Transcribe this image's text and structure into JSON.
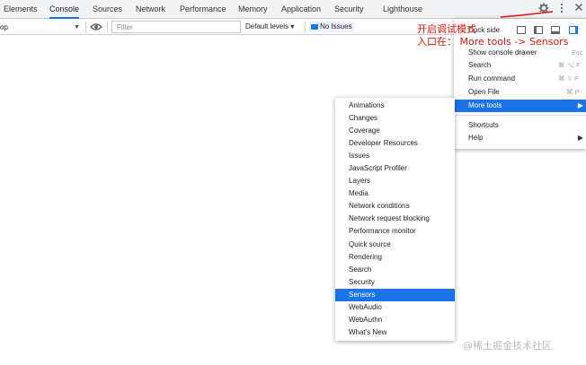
{
  "tabs": [
    {
      "label": "Elements",
      "active": false
    },
    {
      "label": "Console",
      "active": true
    },
    {
      "label": "Sources",
      "active": false
    },
    {
      "label": "Network",
      "active": false
    },
    {
      "label": "Performance",
      "active": false
    },
    {
      "label": "Memory",
      "active": false
    },
    {
      "label": "Application",
      "active": false
    },
    {
      "label": "Security",
      "active": false
    },
    {
      "label": "Lighthouse",
      "active": false
    }
  ],
  "toolbar": {
    "context_value": "op",
    "filter_placeholder": "Filter",
    "levels_label": "Default levels ▾",
    "issues_label": "No Issues"
  },
  "main_menu": {
    "dock_side_label": "Dock side",
    "items": [
      {
        "label": "Show console drawer",
        "shortcut": "Esc",
        "highlighted": false
      },
      {
        "label": "Search",
        "shortcut": "⌘ ⌥ F",
        "highlighted": false
      },
      {
        "label": "Run command",
        "shortcut": "⌘ ⇧ P",
        "highlighted": false
      },
      {
        "label": "Open File",
        "shortcut": "⌘ P",
        "highlighted": false
      },
      {
        "label": "More tools",
        "shortcut": "",
        "submenu_arrow": "▶",
        "highlighted": true
      },
      {
        "label": "Shortcuts",
        "shortcut": "",
        "highlighted": false
      },
      {
        "label": "Help",
        "shortcut": "",
        "submenu_arrow": "▶",
        "highlighted": false
      }
    ]
  },
  "more_tools": {
    "items": [
      "Animations",
      "Changes",
      "Coverage",
      "Developer Resources",
      "Issues",
      "JavaScript Profiler",
      "Layers",
      "Media",
      "Network conditions",
      "Network request blocking",
      "Performance monitor",
      "Quick source",
      "Rendering",
      "Search",
      "Security",
      "Sensors",
      "WebAudio",
      "WebAuthn",
      "What's New"
    ],
    "highlighted": "Sensors"
  },
  "annotation": {
    "line1": "开启调试模式",
    "line2": "入口在：  More tools -> Sensors"
  },
  "watermark": "@稀土掘金技术社区",
  "colors": {
    "accent": "#1a73e8",
    "annotation_red": "#e3120b",
    "tabbar_bg": "#f1f3f4"
  },
  "icons": [
    "settings-gear-icon",
    "more-vert-icon",
    "close-icon",
    "eye-icon",
    "message-icon",
    "undock-icon",
    "dock-left-icon",
    "dock-bottom-icon",
    "dock-right-icon"
  ]
}
